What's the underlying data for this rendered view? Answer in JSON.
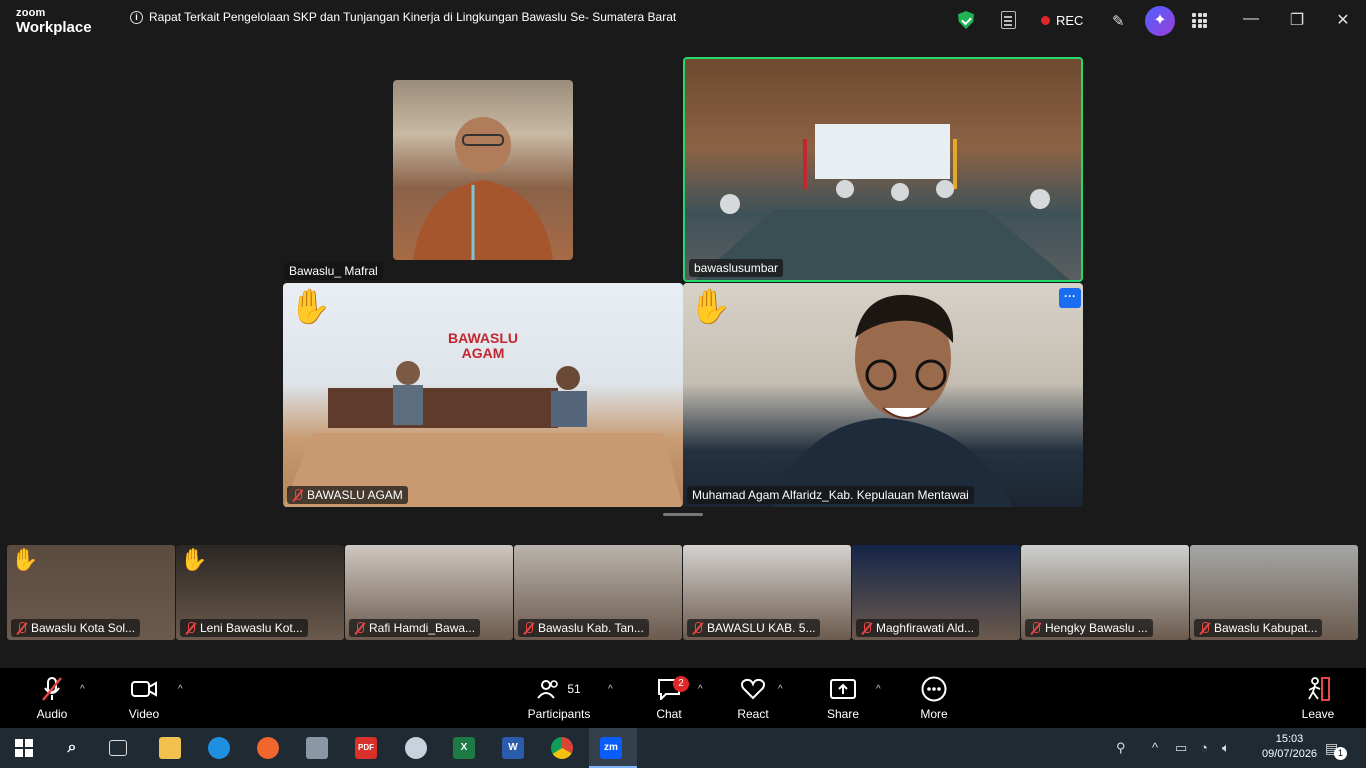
{
  "app": {
    "logo_line1": "zoom",
    "logo_line2": "Workplace"
  },
  "meeting": {
    "title": "Rapat Terkait Pengelolaan SKP dan Tunjangan Kinerja di Lingkungan Bawaslu Se- Sumatera Barat",
    "rec_label": "REC"
  },
  "window_controls": {
    "minimize": "—",
    "restore": "❐",
    "close": "✕"
  },
  "main_tiles": {
    "mafral": "Bawaslu_ Mafral",
    "sumbar": "bawaslusumbar",
    "agam": "BAWASLU AGAM",
    "agam_sign": "BAWASLU\nAGAM",
    "mentawai": "Muhamad Agam Alfaridz_Kab. Kepulauan Mentawai",
    "more_label": "···"
  },
  "strip": [
    {
      "label": "Bawaslu Kota Sol...",
      "raised_hand": true,
      "color": "#5b4a3e"
    },
    {
      "label": "Leni Bawaslu Kot...",
      "raised_hand": true,
      "color": "#2b2724"
    },
    {
      "label": "Rafi Hamdi_Bawa...",
      "raised_hand": false,
      "color": "#cfc7c1"
    },
    {
      "label": "Bawaslu Kab. Tan...",
      "raised_hand": false,
      "color": "#b9b3ad"
    },
    {
      "label": "BAWASLU KAB. 5...",
      "raised_hand": false,
      "color": "#d5d2d0"
    },
    {
      "label": "Maghfirawati Ald...",
      "raised_hand": false,
      "color": "#142448"
    },
    {
      "label": "Hengky Bawaslu ...",
      "raised_hand": false,
      "color": "#cfd1cf"
    },
    {
      "label": "Bawaslu Kabupat...",
      "raised_hand": false,
      "color": "#a5a7a6"
    }
  ],
  "toolbar": {
    "audio": "Audio",
    "video": "Video",
    "participants": "Participants",
    "participants_count": "51",
    "chat": "Chat",
    "chat_badge": "2",
    "react": "React",
    "share": "Share",
    "more": "More",
    "leave": "Leave"
  },
  "taskbar": {
    "time": "15:03",
    "date": "09/07/2026",
    "notification_count": "1",
    "apps": [
      "start",
      "search",
      "task-view",
      "file-explorer",
      "edge",
      "firefox",
      "camera",
      "pdf",
      "paint",
      "excel",
      "word",
      "chrome",
      "zoom"
    ]
  },
  "colors": {
    "active_speaker_border": "#23d96b",
    "raise_hand": "#f4b82c",
    "mute_red": "#e64646",
    "rec_red": "#e02828"
  }
}
